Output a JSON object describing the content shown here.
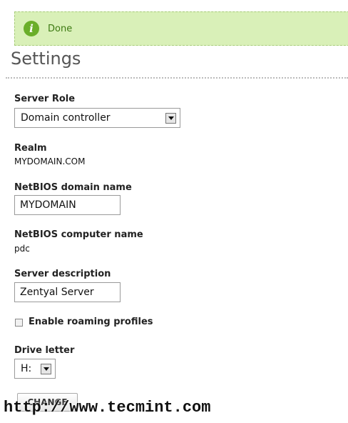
{
  "notice": {
    "icon": "info-icon",
    "text": "Done"
  },
  "page": {
    "title": "Settings"
  },
  "form": {
    "server_role": {
      "label": "Server Role",
      "value": "Domain controller"
    },
    "realm": {
      "label": "Realm",
      "value": "MYDOMAIN.COM"
    },
    "netbios_domain": {
      "label": "NetBIOS domain name",
      "value": "MYDOMAIN"
    },
    "netbios_computer": {
      "label": "NetBIOS computer name",
      "value": "pdc"
    },
    "server_description": {
      "label": "Server description",
      "value": "Zentyal Server"
    },
    "roaming_profiles": {
      "label": "Enable roaming profiles",
      "checked": false
    },
    "drive_letter": {
      "label": "Drive letter",
      "value": "H:"
    },
    "change_button": "CHANGE"
  },
  "watermark": "http://www.tecmint.com",
  "colors": {
    "notice_bg": "#d9f0b8",
    "notice_text": "#3d7a12",
    "info_icon": "#6aae2a"
  }
}
